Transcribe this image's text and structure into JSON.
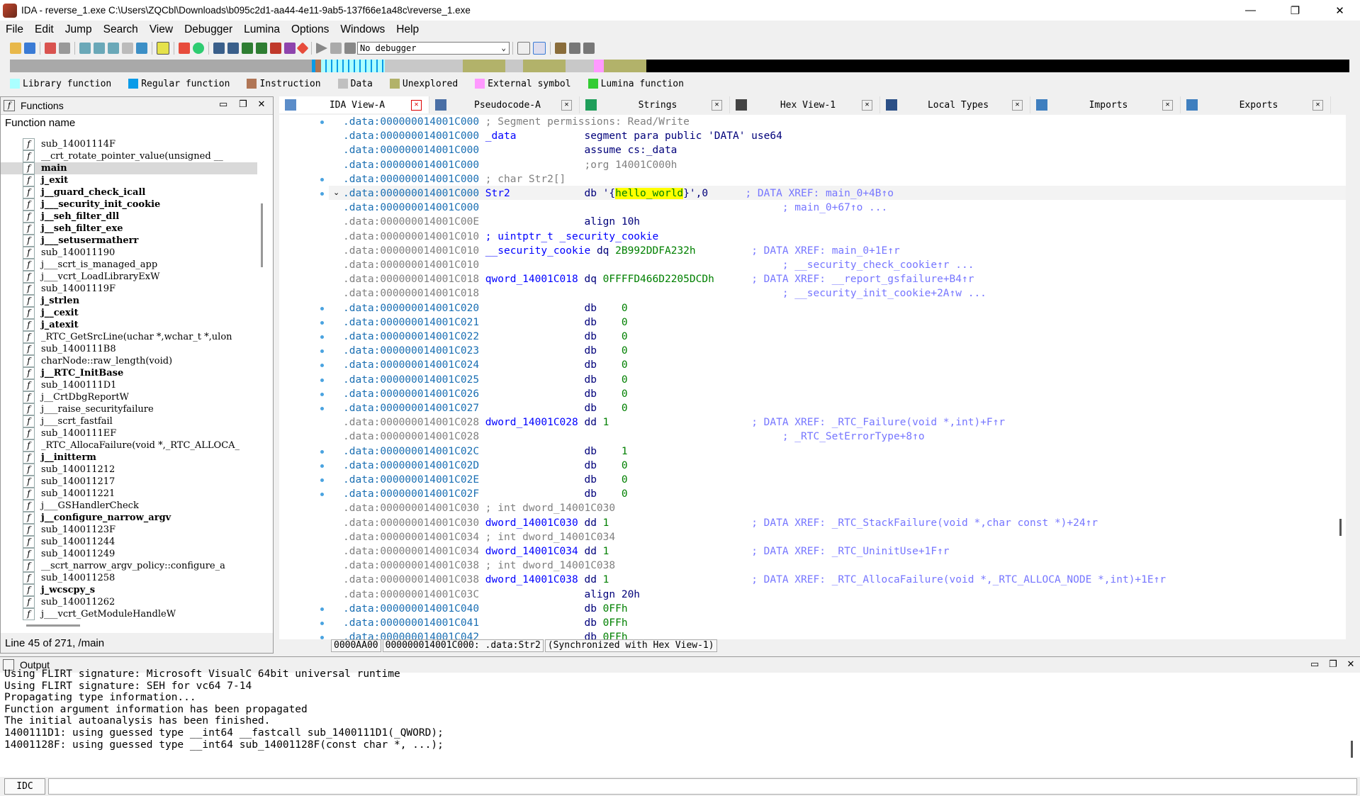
{
  "window": {
    "title": "IDA - reverse_1.exe C:\\Users\\ZQCbl\\Downloads\\b095c2d1-aa44-4e11-9ab5-137f66e1a48c\\reverse_1.exe",
    "minimize": "—",
    "maximize": "❐",
    "close": "✕"
  },
  "menu": [
    "File",
    "Edit",
    "Jump",
    "Search",
    "View",
    "Debugger",
    "Lumina",
    "Options",
    "Windows",
    "Help"
  ],
  "toolbar": {
    "debugger_select": "No debugger"
  },
  "legend": [
    {
      "label": "Library function",
      "color": "#aaffff"
    },
    {
      "label": "Regular function",
      "color": "#0a9be8"
    },
    {
      "label": "Instruction",
      "color": "#b07555"
    },
    {
      "label": "Data",
      "color": "#c0c0c0"
    },
    {
      "label": "Unexplored",
      "color": "#b2b26a"
    },
    {
      "label": "External symbol",
      "color": "#ff99ff"
    },
    {
      "label": "Lumina function",
      "color": "#33cc33"
    }
  ],
  "functions": {
    "title": "Functions",
    "column_header": "Function name",
    "items": [
      {
        "name": "sub_14001114F",
        "bold": false
      },
      {
        "name": "__crt_rotate_pointer_value(unsigned __",
        "bold": false
      },
      {
        "name": "main",
        "bold": true,
        "selected": true
      },
      {
        "name": "j_exit",
        "bold": true
      },
      {
        "name": "j__guard_check_icall",
        "bold": true
      },
      {
        "name": "j___security_init_cookie",
        "bold": true
      },
      {
        "name": "j__seh_filter_dll",
        "bold": true
      },
      {
        "name": "j__seh_filter_exe",
        "bold": true
      },
      {
        "name": "j___setusermatherr",
        "bold": true
      },
      {
        "name": "sub_140011190",
        "bold": false
      },
      {
        "name": "j___scrt_is_managed_app",
        "bold": false
      },
      {
        "name": "j___vcrt_LoadLibraryExW",
        "bold": false
      },
      {
        "name": "sub_14001119F",
        "bold": false
      },
      {
        "name": "j_strlen",
        "bold": true
      },
      {
        "name": "j__cexit",
        "bold": true
      },
      {
        "name": "j_atexit",
        "bold": true
      },
      {
        "name": "_RTC_GetSrcLine(uchar *,wchar_t *,ulon",
        "bold": false
      },
      {
        "name": "sub_1400111B8",
        "bold": false
      },
      {
        "name": "charNode::raw_length(void)",
        "bold": false
      },
      {
        "name": "j__RTC_InitBase",
        "bold": true
      },
      {
        "name": "sub_1400111D1",
        "bold": false
      },
      {
        "name": "j__CrtDbgReportW",
        "bold": false
      },
      {
        "name": "j___raise_securityfailure",
        "bold": false
      },
      {
        "name": "j___scrt_fastfail",
        "bold": false
      },
      {
        "name": "sub_1400111EF",
        "bold": false
      },
      {
        "name": "_RTC_AllocaFailure(void *,_RTC_ALLOCA_",
        "bold": false
      },
      {
        "name": "j__initterm",
        "bold": true
      },
      {
        "name": "sub_140011212",
        "bold": false
      },
      {
        "name": "sub_140011217",
        "bold": false
      },
      {
        "name": "sub_140011221",
        "bold": false
      },
      {
        "name": "j___GSHandlerCheck",
        "bold": false
      },
      {
        "name": "j__configure_narrow_argv",
        "bold": true
      },
      {
        "name": "sub_14001123F",
        "bold": false
      },
      {
        "name": "sub_140011244",
        "bold": false
      },
      {
        "name": "sub_140011249",
        "bold": false
      },
      {
        "name": "__scrt_narrow_argv_policy::configure_a",
        "bold": false
      },
      {
        "name": "sub_140011258",
        "bold": false
      },
      {
        "name": "j_wcscpy_s",
        "bold": true
      },
      {
        "name": "sub_140011262",
        "bold": false
      },
      {
        "name": "j___vcrt_GetModuleHandleW",
        "bold": false
      }
    ],
    "status": "Line 45 of 271, /main"
  },
  "tabs": [
    {
      "label": "IDA View-A",
      "icon": "ida-view-icon",
      "active": true
    },
    {
      "label": "Pseudocode-A",
      "icon": "pseudocode-icon"
    },
    {
      "label": "Strings",
      "icon": "strings-icon"
    },
    {
      "label": "Hex View-1",
      "icon": "hex-view-icon"
    },
    {
      "label": "Local Types",
      "icon": "local-types-icon"
    },
    {
      "label": "Imports",
      "icon": "imports-icon"
    },
    {
      "label": "Exports",
      "icon": "exports-icon"
    }
  ],
  "disasm": [
    {
      "addr": ".data:000000014001C000",
      "dot": true,
      "parts": [
        {
          "t": " ; Segment permissions: Read/Write",
          "c": "cmt"
        }
      ]
    },
    {
      "addr": ".data:000000014001C000",
      "parts": [
        {
          "t": " _data           ",
          "c": "lbl"
        },
        {
          "t": "segment para public 'DATA' use64",
          "c": "kw"
        }
      ]
    },
    {
      "addr": ".data:000000014001C000",
      "parts": [
        {
          "t": "                 ",
          "c": ""
        },
        {
          "t": "assume cs:_data",
          "c": "kw"
        }
      ]
    },
    {
      "addr": ".data:000000014001C000",
      "parts": [
        {
          "t": "                 ",
          "c": ""
        },
        {
          "t": ";org 14001C000h",
          "c": "cmt"
        }
      ]
    },
    {
      "addr": ".data:000000014001C000",
      "dot": true,
      "parts": [
        {
          "t": " ; char Str2[]",
          "c": "cmt"
        }
      ]
    },
    {
      "addr": ".data:000000014001C000",
      "dot": true,
      "current": true,
      "parts": [
        {
          "t": " Str2            ",
          "c": "lbl"
        },
        {
          "t": "db '{",
          "c": "kw"
        },
        {
          "t": "hello_world",
          "c": "hl"
        },
        {
          "t": "}',0",
          "c": "kw"
        },
        {
          "t": "      ; DATA XREF: main_0+4B↑o",
          "c": "xref"
        }
      ]
    },
    {
      "addr": ".data:000000014001C000",
      "parts": [
        {
          "t": "                                                 ; main_0+67↑o ...",
          "c": "xref"
        }
      ]
    },
    {
      "addr": ".data:000000014001C00E",
      "dim": true,
      "parts": [
        {
          "t": "                 ",
          "c": ""
        },
        {
          "t": "align 10h",
          "c": "kw"
        }
      ]
    },
    {
      "addr": ".data:000000014001C010",
      "dim": true,
      "parts": [
        {
          "t": " ; uintptr_t _security_cookie",
          "c": "lbl"
        }
      ]
    },
    {
      "addr": ".data:000000014001C010",
      "dim": true,
      "parts": [
        {
          "t": " __security_cookie ",
          "c": "lbl"
        },
        {
          "t": "dq ",
          "c": "kw"
        },
        {
          "t": "2B992DDFA232h",
          "c": "num"
        },
        {
          "t": "         ; DATA XREF: main_0+1E↑r",
          "c": "xref"
        }
      ]
    },
    {
      "addr": ".data:000000014001C010",
      "dim": true,
      "parts": [
        {
          "t": "                                                 ; __security_check_cookie↑r ...",
          "c": "xref"
        }
      ]
    },
    {
      "addr": ".data:000000014001C018",
      "dim": true,
      "parts": [
        {
          "t": " qword_14001C018 ",
          "c": "lbl"
        },
        {
          "t": "dq ",
          "c": "kw"
        },
        {
          "t": "0FFFFD466D2205DCDh",
          "c": "num"
        },
        {
          "t": "      ; DATA XREF: __report_gsfailure+B4↑r",
          "c": "xref"
        }
      ]
    },
    {
      "addr": ".data:000000014001C018",
      "dim": true,
      "parts": [
        {
          "t": "                                                 ; __security_init_cookie+2A↑w ...",
          "c": "xref"
        }
      ]
    },
    {
      "addr": ".data:000000014001C020",
      "dot": true,
      "parts": [
        {
          "t": "                 ",
          "c": ""
        },
        {
          "t": "db    ",
          "c": "kw"
        },
        {
          "t": "0",
          "c": "num"
        }
      ]
    },
    {
      "addr": ".data:000000014001C021",
      "dot": true,
      "parts": [
        {
          "t": "                 ",
          "c": ""
        },
        {
          "t": "db    ",
          "c": "kw"
        },
        {
          "t": "0",
          "c": "num"
        }
      ]
    },
    {
      "addr": ".data:000000014001C022",
      "dot": true,
      "parts": [
        {
          "t": "                 ",
          "c": ""
        },
        {
          "t": "db    ",
          "c": "kw"
        },
        {
          "t": "0",
          "c": "num"
        }
      ]
    },
    {
      "addr": ".data:000000014001C023",
      "dot": true,
      "parts": [
        {
          "t": "                 ",
          "c": ""
        },
        {
          "t": "db    ",
          "c": "kw"
        },
        {
          "t": "0",
          "c": "num"
        }
      ]
    },
    {
      "addr": ".data:000000014001C024",
      "dot": true,
      "parts": [
        {
          "t": "                 ",
          "c": ""
        },
        {
          "t": "db    ",
          "c": "kw"
        },
        {
          "t": "0",
          "c": "num"
        }
      ]
    },
    {
      "addr": ".data:000000014001C025",
      "dot": true,
      "parts": [
        {
          "t": "                 ",
          "c": ""
        },
        {
          "t": "db    ",
          "c": "kw"
        },
        {
          "t": "0",
          "c": "num"
        }
      ]
    },
    {
      "addr": ".data:000000014001C026",
      "dot": true,
      "parts": [
        {
          "t": "                 ",
          "c": ""
        },
        {
          "t": "db    ",
          "c": "kw"
        },
        {
          "t": "0",
          "c": "num"
        }
      ]
    },
    {
      "addr": ".data:000000014001C027",
      "dot": true,
      "parts": [
        {
          "t": "                 ",
          "c": ""
        },
        {
          "t": "db    ",
          "c": "kw"
        },
        {
          "t": "0",
          "c": "num"
        }
      ]
    },
    {
      "addr": ".data:000000014001C028",
      "dim": true,
      "parts": [
        {
          "t": " dword_14001C028 ",
          "c": "lbl"
        },
        {
          "t": "dd ",
          "c": "kw"
        },
        {
          "t": "1",
          "c": "num"
        },
        {
          "t": "                       ; DATA XREF: _RTC_Failure(void *,int)+F↑r",
          "c": "xref"
        }
      ]
    },
    {
      "addr": ".data:000000014001C028",
      "dim": true,
      "parts": [
        {
          "t": "                                                 ; _RTC_SetErrorType+8↑o",
          "c": "xref"
        }
      ]
    },
    {
      "addr": ".data:000000014001C02C",
      "dot": true,
      "parts": [
        {
          "t": "                 ",
          "c": ""
        },
        {
          "t": "db    ",
          "c": "kw"
        },
        {
          "t": "1",
          "c": "num"
        }
      ]
    },
    {
      "addr": ".data:000000014001C02D",
      "dot": true,
      "parts": [
        {
          "t": "                 ",
          "c": ""
        },
        {
          "t": "db    ",
          "c": "kw"
        },
        {
          "t": "0",
          "c": "num"
        }
      ]
    },
    {
      "addr": ".data:000000014001C02E",
      "dot": true,
      "parts": [
        {
          "t": "                 ",
          "c": ""
        },
        {
          "t": "db    ",
          "c": "kw"
        },
        {
          "t": "0",
          "c": "num"
        }
      ]
    },
    {
      "addr": ".data:000000014001C02F",
      "dot": true,
      "parts": [
        {
          "t": "                 ",
          "c": ""
        },
        {
          "t": "db    ",
          "c": "kw"
        },
        {
          "t": "0",
          "c": "num"
        }
      ]
    },
    {
      "addr": ".data:000000014001C030",
      "dim": true,
      "parts": [
        {
          "t": " ; int dword_14001C030",
          "c": "cmt"
        }
      ]
    },
    {
      "addr": ".data:000000014001C030",
      "dim": true,
      "parts": [
        {
          "t": " dword_14001C030 ",
          "c": "lbl"
        },
        {
          "t": "dd ",
          "c": "kw"
        },
        {
          "t": "1",
          "c": "num"
        },
        {
          "t": "                       ; DATA XREF: _RTC_StackFailure(void *,char const *)+24↑r",
          "c": "xref"
        }
      ]
    },
    {
      "addr": ".data:000000014001C034",
      "dim": true,
      "parts": [
        {
          "t": " ; int dword_14001C034",
          "c": "cmt"
        }
      ]
    },
    {
      "addr": ".data:000000014001C034",
      "dim": true,
      "parts": [
        {
          "t": " dword_14001C034 ",
          "c": "lbl"
        },
        {
          "t": "dd ",
          "c": "kw"
        },
        {
          "t": "1",
          "c": "num"
        },
        {
          "t": "                       ; DATA XREF: _RTC_UninitUse+1F↑r",
          "c": "xref"
        }
      ]
    },
    {
      "addr": ".data:000000014001C038",
      "dim": true,
      "parts": [
        {
          "t": " ; int dword_14001C038",
          "c": "cmt"
        }
      ]
    },
    {
      "addr": ".data:000000014001C038",
      "dim": true,
      "parts": [
        {
          "t": " dword_14001C038 ",
          "c": "lbl"
        },
        {
          "t": "dd ",
          "c": "kw"
        },
        {
          "t": "1",
          "c": "num"
        },
        {
          "t": "                       ; DATA XREF: _RTC_AllocaFailure(void *,_RTC_ALLOCA_NODE *,int)+1E↑r",
          "c": "xref"
        }
      ]
    },
    {
      "addr": ".data:000000014001C03C",
      "dim": true,
      "parts": [
        {
          "t": "                 ",
          "c": ""
        },
        {
          "t": "align 20h",
          "c": "kw"
        }
      ]
    },
    {
      "addr": ".data:000000014001C040",
      "dot": true,
      "parts": [
        {
          "t": "                 ",
          "c": ""
        },
        {
          "t": "db ",
          "c": "kw"
        },
        {
          "t": "0FFh",
          "c": "num"
        }
      ]
    },
    {
      "addr": ".data:000000014001C041",
      "dot": true,
      "parts": [
        {
          "t": "                 ",
          "c": ""
        },
        {
          "t": "db ",
          "c": "kw"
        },
        {
          "t": "0FFh",
          "c": "num"
        }
      ]
    },
    {
      "addr": ".data:000000014001C042",
      "dot": true,
      "parts": [
        {
          "t": "                 ",
          "c": ""
        },
        {
          "t": "db ",
          "c": "kw"
        },
        {
          "t": "0FFh",
          "c": "num"
        }
      ]
    }
  ],
  "disasm_status": [
    "0000AA00",
    "000000014001C000: .data:Str2",
    "(Synchronized with Hex View-1)"
  ],
  "output": {
    "title": "Output",
    "lines": [
      "Using FLIRT signature: Microsoft VisualC 64bit universal runtime",
      "Using FLIRT signature: SEH for vc64 7-14",
      "Propagating type information...",
      "Function argument information has been propagated",
      "The initial autoanalysis has been finished.",
      "1400111D1: using guessed type __int64 __fastcall sub_1400111D1(_QWORD);",
      "14001128F: using guessed type __int64 sub_14001128F(const char *, ...);"
    ]
  },
  "idc": {
    "label": "IDC"
  }
}
